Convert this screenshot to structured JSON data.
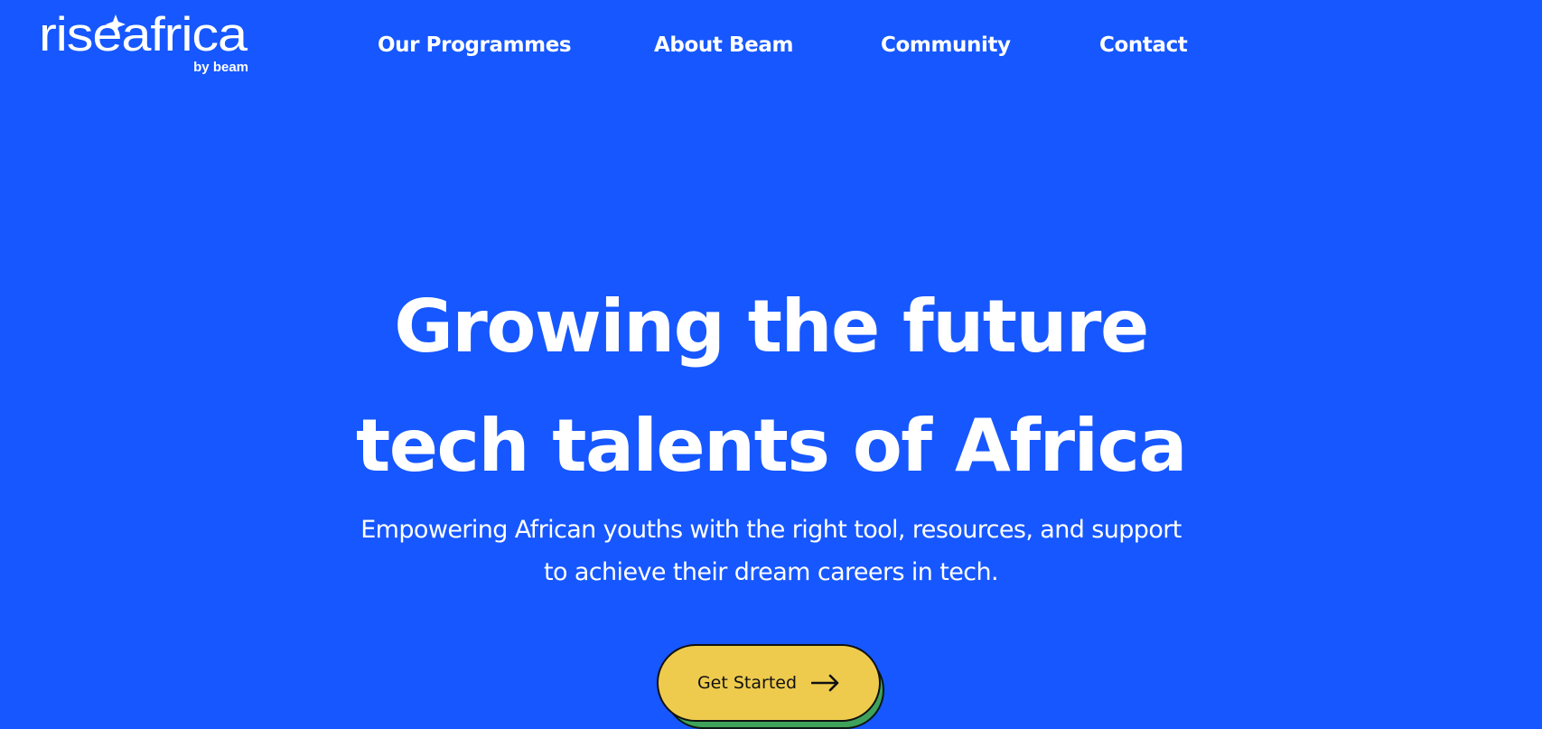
{
  "brand": {
    "logo_text": "riseafrica",
    "logo_sub": "by beam"
  },
  "nav": {
    "items": [
      {
        "label": "Our Programmes"
      },
      {
        "label": "About Beam"
      },
      {
        "label": "Community"
      },
      {
        "label": "Contact"
      }
    ]
  },
  "hero": {
    "title_line1": "Growing the future",
    "title_line2": "tech talents of Africa",
    "subtitle_line1": "Empowering African youths with the right tool, resources, and support",
    "subtitle_line2": "to achieve their dream careers in tech.",
    "cta_label": "Get Started",
    "cta_icon": "arrow-right-icon"
  },
  "colors": {
    "background": "#1657FF",
    "text": "#FFFFFF",
    "cta_fill": "#EECB4D",
    "cta_shadow": "#3FA25A"
  }
}
